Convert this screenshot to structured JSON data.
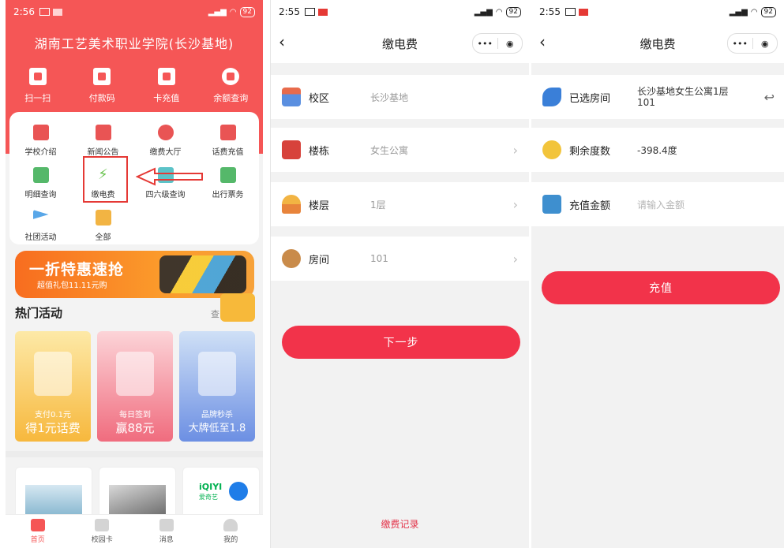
{
  "screen1": {
    "status": {
      "time": "2:56",
      "battery": "92"
    },
    "school_title": "湖南工艺美术职业学院(长沙基地)",
    "hero": [
      {
        "label": "扫一扫",
        "icon": "scan-icon"
      },
      {
        "label": "付款码",
        "icon": "qrcode-icon"
      },
      {
        "label": "卡充值",
        "icon": "card-topup-icon"
      },
      {
        "label": "余额查询",
        "icon": "money-bag-icon"
      }
    ],
    "grid": [
      {
        "label": "学校介绍",
        "icon": "school-icon"
      },
      {
        "label": "新闻公告",
        "icon": "news-icon"
      },
      {
        "label": "缴费大厅",
        "icon": "payment-hall-icon"
      },
      {
        "label": "话费充值",
        "icon": "phone-topup-icon"
      },
      {
        "label": "明细查询",
        "icon": "details-icon"
      },
      {
        "label": "缴电费",
        "icon": "electricity-icon"
      },
      {
        "label": "四六级查询",
        "icon": "cet-icon"
      },
      {
        "label": "出行票务",
        "icon": "travel-ticket-icon"
      },
      {
        "label": "社团活动",
        "icon": "club-flag-icon"
      },
      {
        "label": "全部",
        "icon": "all-apps-icon"
      }
    ],
    "banner": {
      "main": "一折特惠速抢",
      "sub": "超值礼包11.11元购"
    },
    "hot": {
      "title": "热门活动",
      "more": "查"
    },
    "cards": [
      {
        "small": "支付0.1元",
        "main": "得1元话费"
      },
      {
        "small": "每日签到",
        "main": "赢88元"
      },
      {
        "small": "品牌秒杀",
        "main": "大牌低至1.8"
      }
    ],
    "iqiyi": {
      "logo": "iQIYI",
      "sub": "爱奇艺"
    },
    "tabs": [
      {
        "label": "首页",
        "icon": "home-icon"
      },
      {
        "label": "校园卡",
        "icon": "campus-card-icon"
      },
      {
        "label": "消息",
        "icon": "message-icon"
      },
      {
        "label": "我的",
        "icon": "profile-icon"
      }
    ]
  },
  "screen2": {
    "status": {
      "time": "2:55",
      "battery": "92"
    },
    "title": "缴电费",
    "rows": [
      {
        "label": "校区",
        "value": "长沙基地",
        "icon": "campus-building-icon",
        "chevron": false
      },
      {
        "label": "楼栋",
        "value": "女生公寓",
        "icon": "building-icon",
        "chevron": true
      },
      {
        "label": "楼层",
        "value": "1层",
        "icon": "floor-icon",
        "chevron": true
      },
      {
        "label": "房间",
        "value": "101",
        "icon": "room-key-icon",
        "chevron": true
      }
    ],
    "next_button": "下一步",
    "record_link": "缴费记录"
  },
  "screen3": {
    "status": {
      "time": "2:55",
      "battery": "92"
    },
    "title": "缴电费",
    "rows": [
      {
        "label": "已选房间",
        "value": "长沙基地女生公寓1层101",
        "icon": "selected-room-key-icon"
      },
      {
        "label": "剩余度数",
        "value": "-398.4度",
        "icon": "lightbulb-icon"
      },
      {
        "label": "充值金额",
        "placeholder": "请输入金额",
        "icon": "wallet-icon"
      }
    ],
    "recharge_button": "充值"
  },
  "colors": {
    "brand_red": "#f55656",
    "button_red": "#f2334a",
    "highlight": "#e53935"
  }
}
